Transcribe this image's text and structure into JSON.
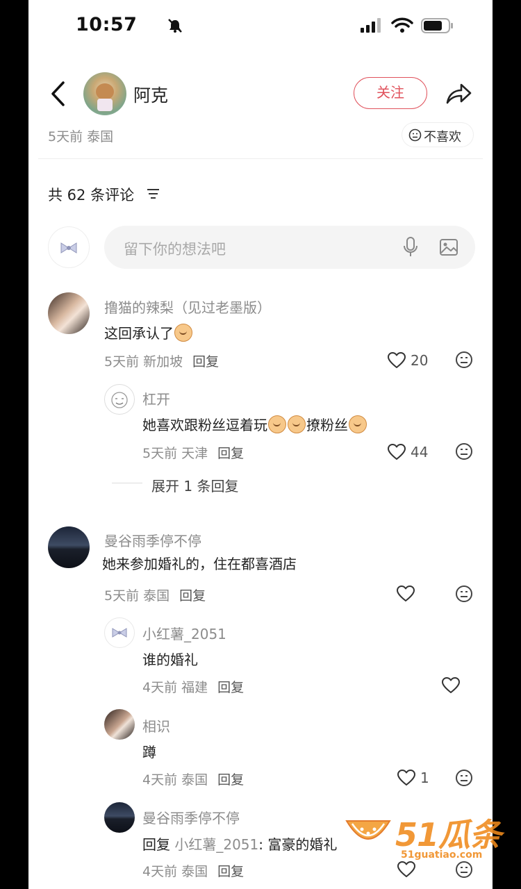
{
  "status": {
    "time": "10:57"
  },
  "post": {
    "author": "阿克",
    "follow_label": "关注",
    "time_location": "5天前 泰国",
    "dislike_label": "不喜欢"
  },
  "comments_header": {
    "count_text": "共 62 条评论"
  },
  "input": {
    "placeholder": "留下你的想法吧"
  },
  "comments": [
    {
      "user": "撸猫的辣梨（见过老墨版）",
      "text": "这回承认了",
      "time": "5天前 新加坡",
      "reply": "回复",
      "likes": "20"
    },
    {
      "user": "杠开",
      "text": "她喜欢跟粉丝逗着玩",
      "text2": "撩粉丝",
      "time": "5天前 天津",
      "reply": "回复",
      "likes": "44"
    },
    {
      "expand": "展开 1 条回复"
    },
    {
      "user": "曼谷雨季停不停",
      "text": "她来参加婚礼的，住在都喜酒店",
      "time": "5天前 泰国",
      "reply": "回复"
    },
    {
      "user": "小红薯_2051",
      "text": "谁的婚礼",
      "time": "4天前 福建",
      "reply": "回复"
    },
    {
      "user": "相识",
      "text": "蹲",
      "time": "4天前 泰国",
      "reply": "回复",
      "likes": "1"
    },
    {
      "user": "曼谷雨季停不停",
      "text_prefix": "回复",
      "mention": "小红薯_2051",
      "text": ": 富豪的婚礼",
      "time": "4天前 泰国",
      "reply": "回复"
    }
  ],
  "watermark": {
    "brand": "51瓜条",
    "url": "51guatiao.com"
  }
}
